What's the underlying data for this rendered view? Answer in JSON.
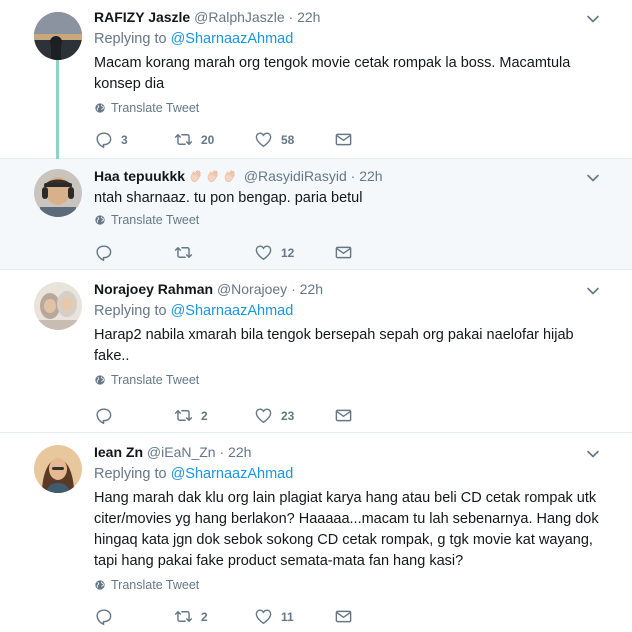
{
  "tweets": [
    {
      "name": "RAFIZY Jaszle",
      "handle": "@RalphJaszle",
      "dot": "·",
      "time": "22h",
      "replying_prefix": "Replying to ",
      "replying_to": "@SharnaazAhmad",
      "text": "Macam korang marah org tengok movie cetak rompak la boss. Macamtula konsep dia",
      "translate": "Translate Tweet",
      "replies": "3",
      "retweets": "20",
      "likes": "58"
    },
    {
      "name": "Haa tepuukkk",
      "handle": "@RasyidiRasyid",
      "dot": "·",
      "time": "22h",
      "text": "ntah sharnaaz. tu pon bengap. paria betul",
      "translate": "Translate Tweet",
      "replies": "",
      "retweets": "",
      "likes": "12"
    },
    {
      "name": "Norajoey Rahman",
      "handle": "@Norajoey",
      "dot": "·",
      "time": "22h",
      "replying_prefix": "Replying to ",
      "replying_to": "@SharnaazAhmad",
      "text": "Harap2 nabila xmarah bila tengok bersepah sepah org pakai naelofar hijab fake..",
      "translate": "Translate Tweet",
      "replies": "",
      "retweets": "2",
      "likes": "23"
    },
    {
      "name": "Iean Zn",
      "handle": "@iEaN_Zn",
      "dot": "·",
      "time": "22h",
      "replying_prefix": "Replying to ",
      "replying_to": "@SharnaazAhmad",
      "text": "Hang marah dak klu org lain plagiat karya hang atau beli CD cetak rompak utk citer/movies yg hang berlakon? Haaaaa...macam tu lah sebenarnya. Hang dok hingaq kata jgn dok sebok sokong CD cetak rompak, g tgk movie kat wayang, tapi hang pakai fake product semata-mata fan hang kasi?",
      "translate": "Translate Tweet",
      "replies": "",
      "retweets": "2",
      "likes": "11"
    }
  ],
  "icons": {
    "reply": "reply-icon",
    "retweet": "retweet-icon",
    "like": "heart-icon",
    "dm": "envelope-icon",
    "globe": "globe-icon",
    "caret": "chevron-down-icon",
    "clap": "clapping-hands-emoji"
  },
  "colors": {
    "link": "#1b95e0",
    "muted": "#657786",
    "thread_line": "#8fd1c6",
    "divider": "#e6ecf0"
  }
}
